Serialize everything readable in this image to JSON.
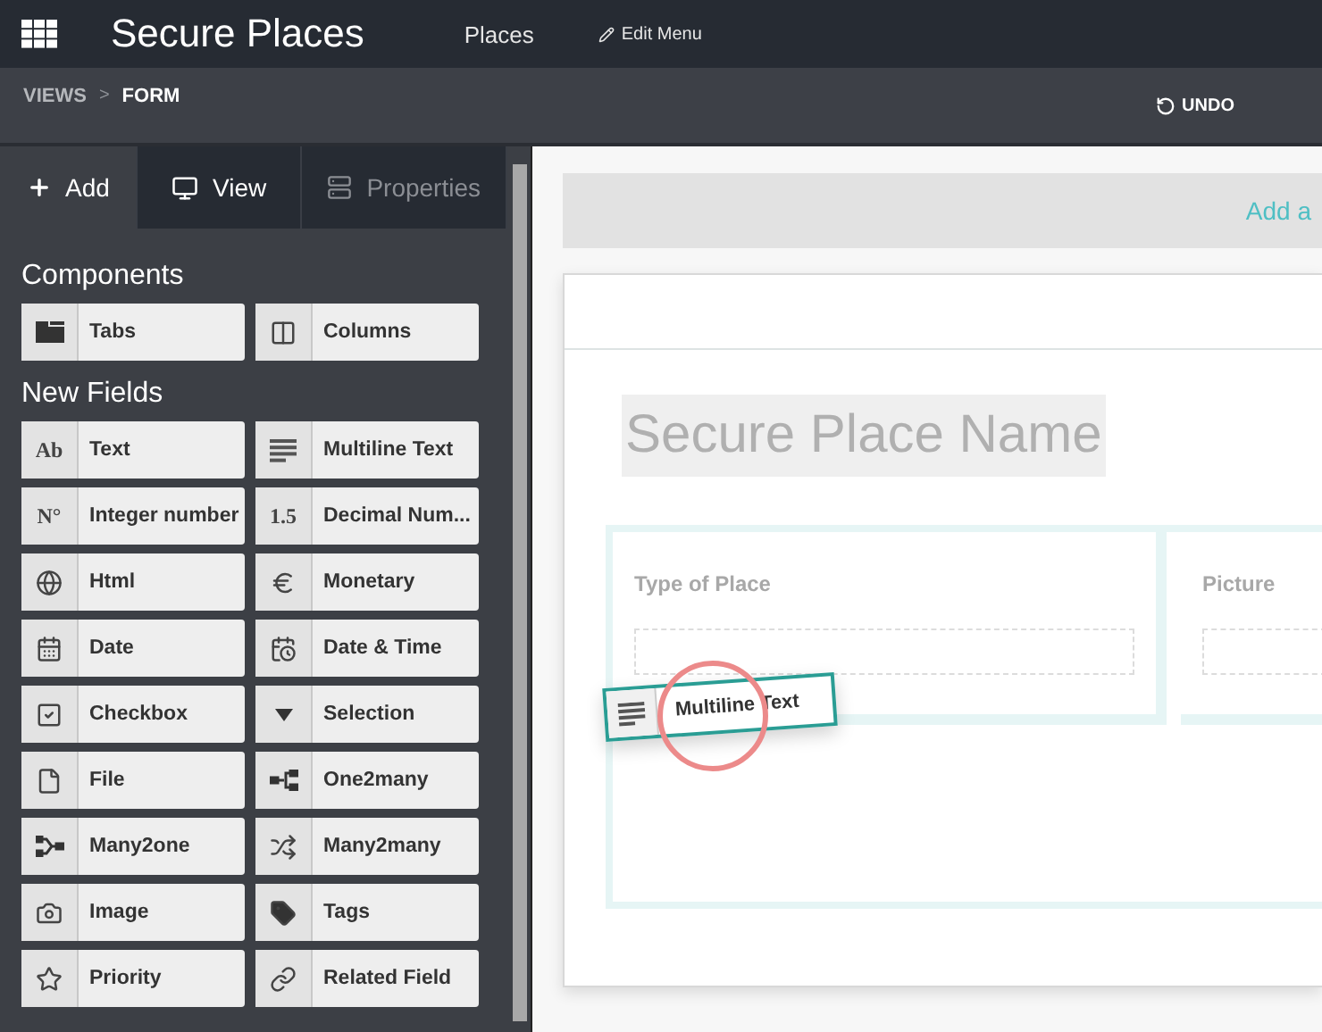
{
  "app": {
    "title": "Secure Places",
    "menu": [
      {
        "label": "Places",
        "kind": "link"
      },
      {
        "label": "Edit Menu",
        "kind": "edit"
      }
    ]
  },
  "breadcrumb": {
    "items": [
      {
        "label": "VIEWS",
        "selected": false
      },
      {
        "label": "FORM",
        "selected": true
      }
    ],
    "separator": ">",
    "undo": "UNDO"
  },
  "sidebar": {
    "tabs": [
      {
        "label": "Add",
        "kind": "plus",
        "selected": true,
        "disabled": false
      },
      {
        "label": "View",
        "kind": "monitor",
        "selected": false,
        "disabled": false
      },
      {
        "label": "Properties",
        "kind": "server",
        "selected": false,
        "disabled": true
      }
    ],
    "sections": [
      {
        "title": "Components",
        "items": [
          {
            "label": "Tabs",
            "kind": "tabs"
          },
          {
            "label": "Columns",
            "kind": "columns"
          }
        ]
      },
      {
        "title": "New Fields",
        "items": [
          {
            "label": "Text",
            "kind": "glyph",
            "glyph": "Ab"
          },
          {
            "label": "Multiline Text",
            "kind": "lines"
          },
          {
            "label": "Integer number",
            "kind": "glyph",
            "glyph": "N°"
          },
          {
            "label": "Decimal Num...",
            "kind": "glyph",
            "glyph": "1.5"
          },
          {
            "label": "Html",
            "kind": "globe"
          },
          {
            "label": "Monetary",
            "kind": "euro"
          },
          {
            "label": "Date",
            "kind": "date"
          },
          {
            "label": "Date & Time",
            "kind": "datetime"
          },
          {
            "label": "Checkbox",
            "kind": "checkbox"
          },
          {
            "label": "Selection",
            "kind": "caret"
          },
          {
            "label": "File",
            "kind": "file"
          },
          {
            "label": "One2many",
            "kind": "one2many"
          },
          {
            "label": "Many2one",
            "kind": "many2one"
          },
          {
            "label": "Many2many",
            "kind": "many2many"
          },
          {
            "label": "Image",
            "kind": "camera"
          },
          {
            "label": "Tags",
            "kind": "tag"
          },
          {
            "label": "Priority",
            "kind": "star"
          },
          {
            "label": "Related Field",
            "kind": "link"
          }
        ]
      }
    ]
  },
  "canvas": {
    "add_link": "Add a",
    "form_title": "Secure Place Name",
    "fields": [
      {
        "label": "Type of Place"
      },
      {
        "label": "Picture"
      }
    ],
    "dragged": {
      "label": "Multiline Text",
      "kind": "lines"
    }
  }
}
